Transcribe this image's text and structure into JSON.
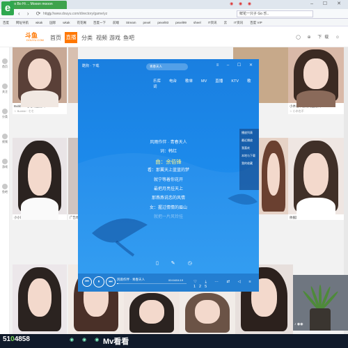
{
  "browser": {
    "tab_title": "Bo Bo Hi ... Mooon mooon",
    "url": "https://www.douyu.com/directory/game/yz",
    "right_field": "鲜花一只子 Go 乐..",
    "tab_icons": "◉ ◉ ◉",
    "window_buttons": "– ☐ ✕",
    "bookmarks": [
      "百度",
      "网址导航",
      "wkak",
      "国际",
      "wkak",
      "花花阁",
      "百度一下",
      "前端",
      "Stream",
      "pexel",
      "pexel93",
      "pexel99",
      "sheel",
      "IT资讯",
      "云",
      "IT资讯",
      "百度 VIP"
    ]
  },
  "site": {
    "logo": "斗鱼",
    "logo_sub": "DOUYU.COM",
    "nav": [
      "首页",
      "直播",
      "分类",
      "视频",
      "游戏",
      "鱼吧"
    ],
    "header_right": "◯ ⊕ 下载 ☺"
  },
  "sidebar": [
    {
      "icon": "home-icon",
      "label": "首页"
    },
    {
      "icon": "star-icon",
      "label": "关注"
    },
    {
      "icon": "cat-icon",
      "label": "分类"
    },
    {
      "icon": "video-icon",
      "label": "视频"
    },
    {
      "icon": "game-icon",
      "label": "游戏"
    },
    {
      "icon": "fish-icon",
      "label": "鱼吧"
    }
  ],
  "thumbs": [
    {
      "caption": "Bubble~ 七七的直播间",
      "meta": "☆ Bubble~ 七七"
    },
    {
      "caption": "小木也跟你的... 直播",
      "meta": "☆ 小木"
    },
    {
      "caption": "小小阿拉播~",
      "meta": "☆ 小小阿拉"
    },
    {
      "caption": "广告你们~",
      "meta": "☆ 七"
    },
    {
      "caption": "小木也不会做的直播间",
      "meta": "☆ 小木也不"
    },
    {
      "caption": "依据欧美风的直播间",
      "meta": "☆ 依据"
    }
  ],
  "player": {
    "brand": "酷狗 · 下载",
    "search": "青春天人",
    "window_buttons": "≡ – ☐ ✕",
    "tabs": [
      "乐库",
      "电台",
      "歌单",
      "MV",
      "直播",
      "KTV",
      "歌词"
    ],
    "lyrics": [
      {
        "text": "风雨作伴 · 青春天人",
        "state": "normal"
      },
      {
        "text": "词：韩红",
        "state": "normal"
      },
      {
        "text": "曲：余佰锋",
        "state": "current"
      },
      {
        "text": "看：那翼天上蓝蓝的梦",
        "state": "normal"
      },
      {
        "text": "就宁等着你花开",
        "state": "normal"
      },
      {
        "text": "最把月亮挂天上",
        "state": "normal"
      },
      {
        "text": "那燕燕说恋的风情",
        "state": "normal"
      },
      {
        "text": "女：握过情情的眉山",
        "state": "normal"
      },
      {
        "text": "就把一片风铃挂",
        "state": "dim"
      }
    ],
    "side_panel": [
      "播放列表",
      "最近播放",
      "我喜欢",
      "本地与下载",
      "我的收藏"
    ],
    "lyric_tools": "▯ ✎ ◷",
    "song": "风雨作伴 · 青春天人",
    "time": "00:04/04:19",
    "progress": 0.02,
    "controls": "♡ ⤓ ⋯ ⇄ ◁ ≡ 125",
    "buttons": {
      "prev": "⏮",
      "play": "⏸",
      "next": "⏭"
    }
  },
  "plant_audio": "♪ ◉◉",
  "taskbar": {
    "number_a": "51",
    "number_b": "0",
    "number_c": "4858",
    "icons": "◉ ◉ ◉",
    "mv_label": "Mv看看"
  }
}
